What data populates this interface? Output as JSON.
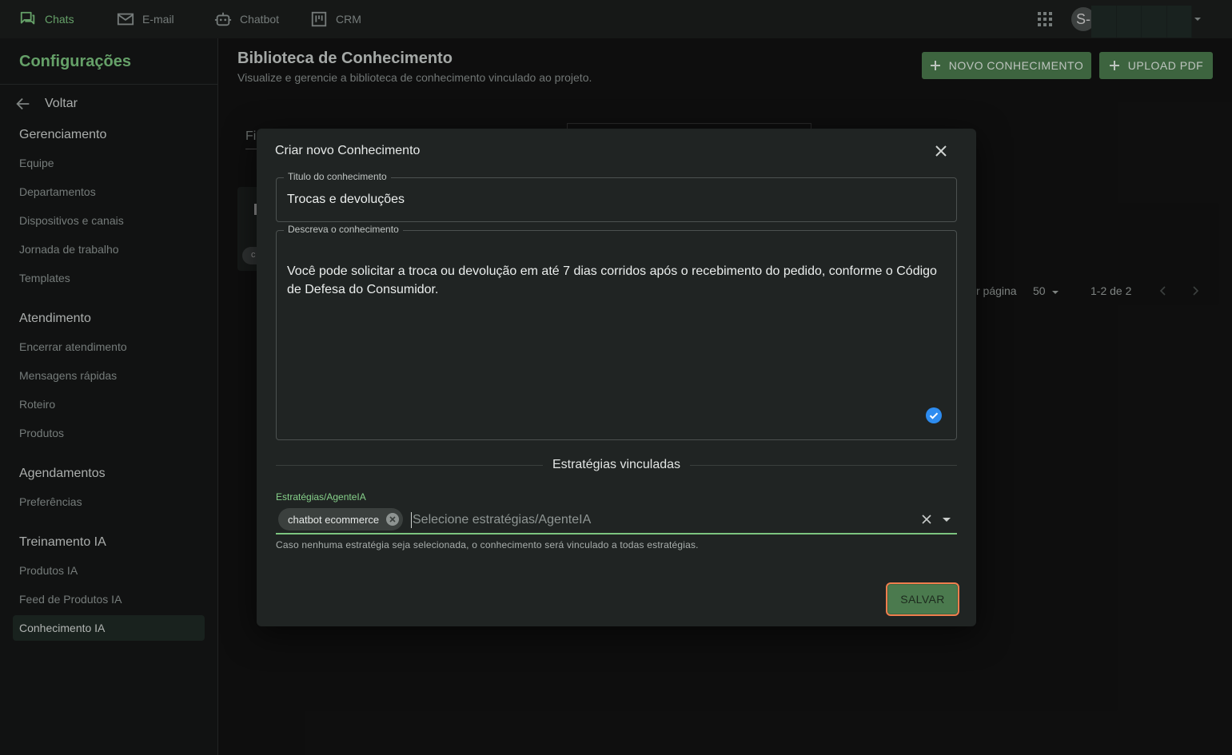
{
  "topnav": {
    "items": [
      {
        "label": "Chats",
        "icon": "chat-bubbles-icon",
        "active": true
      },
      {
        "label": "E-mail",
        "icon": "mail-icon"
      },
      {
        "label": "Chatbot",
        "icon": "robot-icon"
      },
      {
        "label": "CRM",
        "icon": "kanban-icon"
      }
    ],
    "avatar_letter": "S-"
  },
  "sidebar": {
    "title": "Configurações",
    "back_label": "Voltar",
    "sections": [
      {
        "title": "Gerenciamento",
        "items": [
          "Equipe",
          "Departamentos",
          "Dispositivos e canais",
          "Jornada de trabalho",
          "Templates"
        ]
      },
      {
        "title": "Atendimento",
        "items": [
          "Encerrar atendimento",
          "Mensagens rápidas",
          "Roteiro",
          "Produtos"
        ]
      },
      {
        "title": "Agendamentos",
        "items": [
          "Preferências"
        ]
      },
      {
        "title": "Treinamento IA",
        "items": [
          "Produtos IA",
          "Feed de Produtos IA",
          "Conhecimento IA"
        ]
      }
    ]
  },
  "page": {
    "title": "Biblioteca de Conhecimento",
    "subtitle": "Visualize e gerencie a biblioteca de conhecimento vinculado ao projeto.",
    "new_button": "NOVO CONHECIMENTO",
    "upload_button": "UPLOAD PDF",
    "filter_fragment": "Fi",
    "card_chip_fragment": "c",
    "per_page_label": "r página",
    "per_page_value": "50",
    "range": "1-2 de 2"
  },
  "dialog": {
    "title": "Criar novo Conhecimento",
    "title_field": {
      "label": "Titulo do conhecimento",
      "value": "Trocas e devoluções"
    },
    "desc_field": {
      "label": "Descreva o conhecimento",
      "value": "Você pode solicitar a troca ou devolução em até 7 dias corridos após o recebimento do pedido, conforme o Código de Defesa do Consumidor."
    },
    "divider_label": "Estratégias vinculadas",
    "strategies": {
      "label": "Estratégias/AgenteIA",
      "chip": "chatbot ecommerce",
      "placeholder": "Selecione estratégias/AgenteIA",
      "help": "Caso nenhuma estratégia seja selecionada, o conhecimento será vinculado a todas estratégias."
    },
    "save_button": "SALVAR"
  },
  "colors": {
    "accent": "#7cc47f",
    "button": "#4b7a4e",
    "focus_ring": "#f07e4e"
  }
}
